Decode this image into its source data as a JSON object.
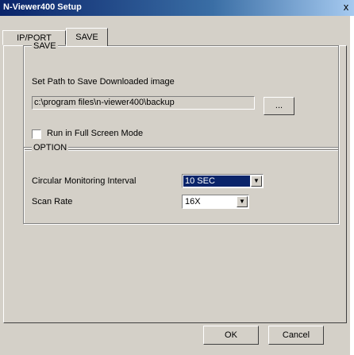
{
  "window": {
    "title": "N-Viewer400 Setup",
    "close_glyph": "x"
  },
  "tabs": [
    {
      "label": "IP/PORT",
      "active": false
    },
    {
      "label": "SAVE",
      "active": true
    }
  ],
  "save_group": {
    "legend": "SAVE",
    "path_label": "Set Path to Save Downloaded image",
    "path_value": "c:\\program files\\n-viewer400\\backup",
    "browse_label": "...",
    "fullscreen_label": "Run in Full Screen Mode",
    "fullscreen_checked": false
  },
  "option_group": {
    "legend": "OPTION",
    "interval_label": "Circular Monitoring Interval",
    "interval_value": "10 SEC",
    "scan_label": "Scan Rate",
    "scan_value": "16X"
  },
  "buttons": {
    "ok": "OK",
    "cancel": "Cancel"
  },
  "colors": {
    "dialog_bg": "#d4d0c8",
    "title_bar": "#0a246a",
    "selection": "#0a246a"
  }
}
